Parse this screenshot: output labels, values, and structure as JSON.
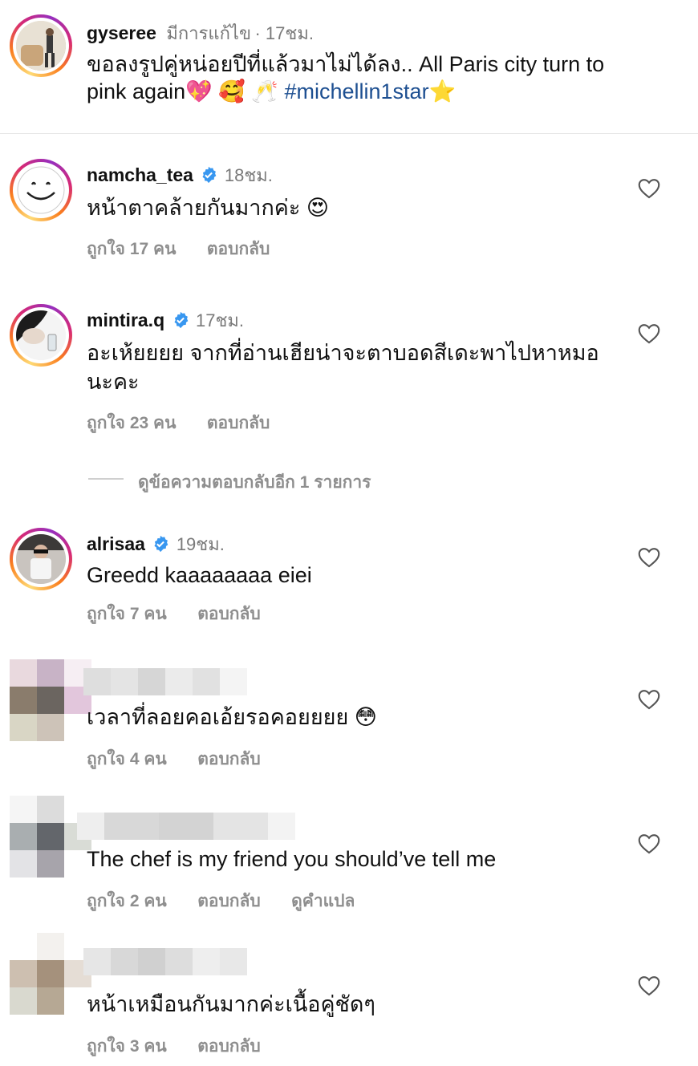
{
  "post": {
    "username": "gyseree",
    "edited": "มีการแก้ไข",
    "time": "· 17ชม.",
    "caption_line1": "ขอลงรูปคู่หน่อยปีที่แล้วมาไม่ได้ลง.. All Paris city turn to",
    "caption_line2_text": "pink again",
    "caption_emojis": "💖 🥰 🥂",
    "caption_tag": "#michellin1star",
    "caption_star": "⭐"
  },
  "comments": [
    {
      "username": "namcha_tea",
      "verified": true,
      "time": "18ชม.",
      "text_lines": [
        "หน้าตาคล้ายกันมากค่ะ 😍"
      ],
      "likes": "ถูกใจ 17 คน",
      "reply": "ตอบกลับ"
    },
    {
      "username": "mintira.q",
      "verified": true,
      "time": "17ชม.",
      "text_lines": [
        "อะเห้ยยยย จากที่อ่านเฮียน่าจะตาบอดสีเดะพาไปหาหมอ",
        "นะคะ"
      ],
      "likes": "ถูกใจ 23 คน",
      "reply": "ตอบกลับ",
      "view_replies": "ดูข้อความตอบกลับอีก 1 รายการ"
    },
    {
      "username": "alrisaa",
      "verified": true,
      "time": "19ชม.",
      "text_lines": [
        "Greedd kaaaaaaaa eiei"
      ],
      "likes": "ถูกใจ 7 คน",
      "reply": "ตอบกลับ"
    },
    {
      "username": "",
      "text_lines": [
        "เวลาที่ลอยคอเอ้ยรอคอยยยย 😳"
      ],
      "likes": "ถูกใจ 4 คน",
      "reply": "ตอบกลับ"
    },
    {
      "username": "",
      "text_lines": [
        "The chef is my friend you should’ve tell me"
      ],
      "likes": "ถูกใจ 2 คน",
      "reply": "ตอบกลับ",
      "translate": "ดูคำแปล"
    },
    {
      "username": "",
      "text_lines": [
        "หน้าเหมือนกันมากค่ะเนื้อคู่ชัดๆ"
      ],
      "likes": "ถูกใจ 3 คน",
      "reply": "ตอบกลับ"
    }
  ],
  "icons": {
    "heart": "heart-outline-icon",
    "verified": "verified-badge-icon"
  },
  "colors": {
    "verified": "#3897f0",
    "hashtag": "#1d4f91",
    "muted": "#8e8e8e"
  }
}
